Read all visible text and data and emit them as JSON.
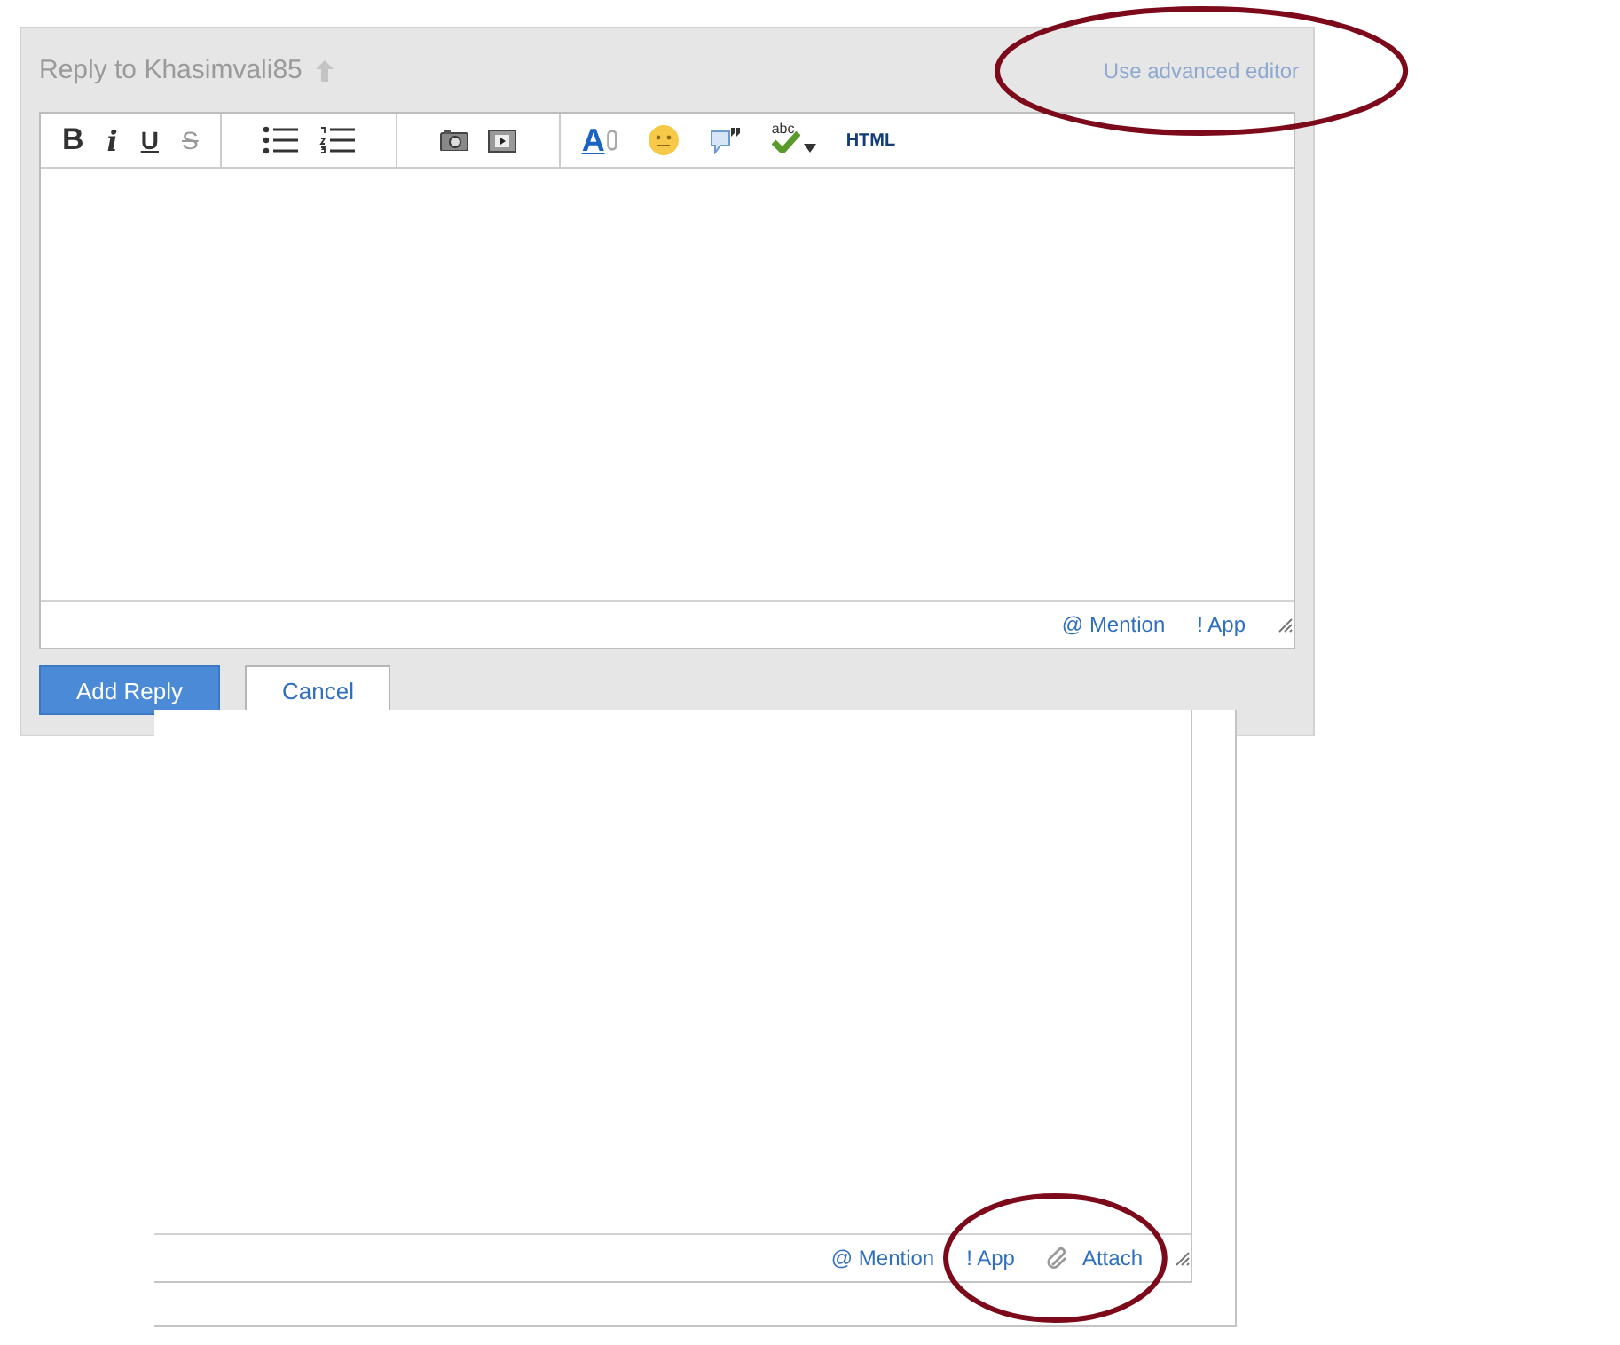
{
  "reply_panel": {
    "title": "Reply to Khasimvali85",
    "advanced_editor": {
      "label": "Use advanced editor"
    },
    "toolbar": [
      [
        {
          "kind": "bold",
          "label": "B"
        },
        {
          "kind": "italic",
          "label": "i"
        },
        {
          "kind": "underline",
          "label": "U"
        },
        {
          "kind": "strike",
          "label": "S"
        }
      ],
      [
        {
          "kind": "bullets"
        },
        {
          "kind": "numbers"
        }
      ],
      [
        {
          "kind": "photo"
        },
        {
          "kind": "video"
        }
      ],
      [
        {
          "kind": "fontcolor",
          "label": "A"
        },
        {
          "kind": "emoji"
        },
        {
          "kind": "quote"
        },
        {
          "kind": "spell",
          "label": "abc"
        },
        {
          "kind": "html",
          "label": "HTML"
        }
      ]
    ],
    "footer_links": [
      {
        "label": "@ Mention"
      },
      {
        "label": "! App"
      }
    ],
    "buttons": [
      {
        "kind": "primary",
        "label": "Add Reply"
      },
      {
        "kind": "secondary",
        "label": "Cancel"
      }
    ]
  },
  "overlay_editor": {
    "footer_links": [
      {
        "kind": "link",
        "label": "@ Mention"
      },
      {
        "kind": "link",
        "label": "! App"
      },
      {
        "kind": "attach",
        "label": "Attach"
      }
    ]
  },
  "annotations": [
    {
      "kind": "ellipse"
    },
    {
      "kind": "ellipse"
    }
  ]
}
